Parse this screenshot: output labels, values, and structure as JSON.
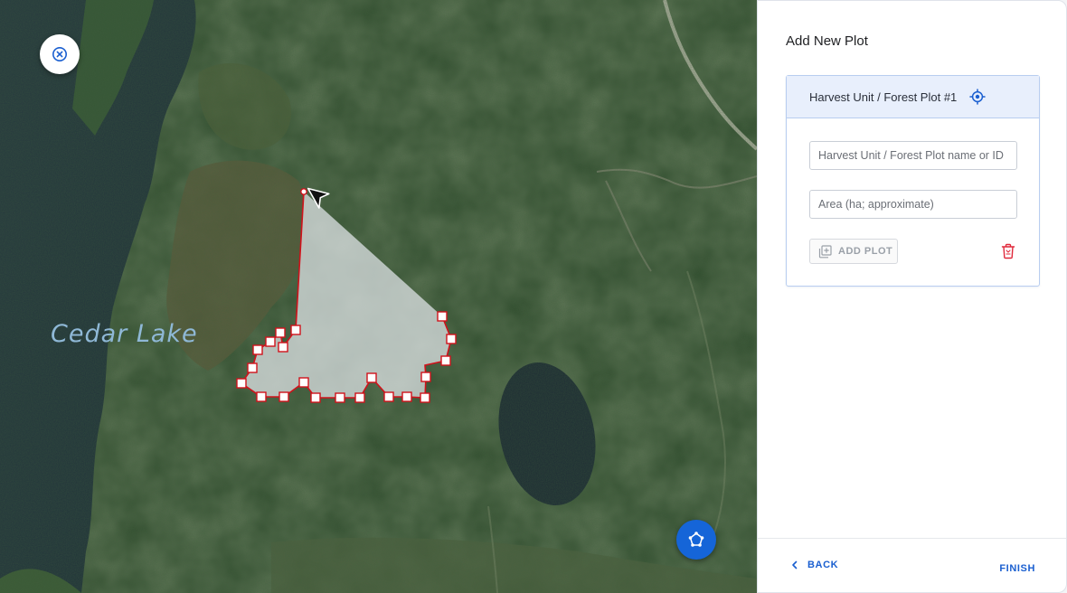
{
  "map": {
    "lake_label": "Cedar Lake",
    "close_icon": "close-circle-icon",
    "draw_icon": "polygon-draw-icon",
    "colors": {
      "polygon_stroke": "#d0121b",
      "polygon_fill": "#e3e7ec",
      "fab": "#1565d8"
    }
  },
  "panel": {
    "title": "Add New Plot",
    "card": {
      "header_title": "Harvest Unit / Forest Plot #1",
      "header_icon": "locate-target-icon",
      "name_field": {
        "value": "",
        "placeholder": "Harvest Unit / Forest Plot name or ID"
      },
      "area_field": {
        "value": "",
        "placeholder": "Area (ha; approximate)"
      },
      "add_plot_label": "ADD PLOT",
      "add_plot_icon": "add-layer-icon",
      "delete_icon": "trash-icon"
    },
    "footer": {
      "back_label": "BACK",
      "finish_label": "FINISH"
    },
    "colors": {
      "accent": "#1a5fd0",
      "danger": "#e0283a",
      "header_bg": "#e8effc"
    }
  }
}
